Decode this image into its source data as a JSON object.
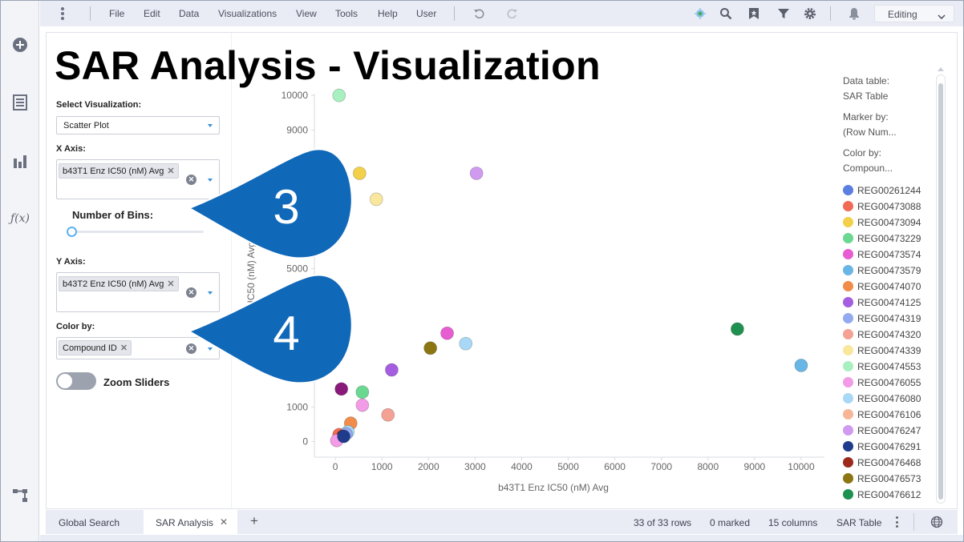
{
  "menubar": {
    "items": [
      "File",
      "Edit",
      "Data",
      "Visualizations",
      "View",
      "Tools",
      "Help",
      "User"
    ],
    "mode": "Editing"
  },
  "page": {
    "title": "SAR Analysis - Visualization"
  },
  "controls": {
    "select_visualization_label": "Select Visualization:",
    "select_visualization_value": "Scatter Plot",
    "x_axis_label": "X Axis:",
    "x_axis_chip": "b43T1 Enz IC50 (nM) Avg",
    "bins_label": "Number of Bins:",
    "y_axis_label": "Y Axis:",
    "y_axis_chip": "b43T2 Enz IC50 (nM) Avg",
    "color_by_label": "Color by:",
    "color_by_chip": "Compound ID",
    "zoom_label": "Zoom Sliders"
  },
  "callouts": [
    "3",
    "4"
  ],
  "legend": {
    "data_table_label": "Data table:",
    "data_table_value": "SAR Table",
    "marker_by_label": "Marker by:",
    "marker_by_value": "(Row Num...",
    "color_by_label": "Color by:",
    "color_by_value": "Compoun...",
    "items": [
      {
        "id": "REG00261244",
        "color": "#5b7fe0"
      },
      {
        "id": "REG00473088",
        "color": "#f06a55"
      },
      {
        "id": "REG00473094",
        "color": "#f3d049"
      },
      {
        "id": "REG00473229",
        "color": "#6ad891"
      },
      {
        "id": "REG00473574",
        "color": "#e85cd2"
      },
      {
        "id": "REG00473579",
        "color": "#69b5e6"
      },
      {
        "id": "REG00474070",
        "color": "#f28c4a"
      },
      {
        "id": "REG00474125",
        "color": "#a55ee0"
      },
      {
        "id": "REG00474319",
        "color": "#93aaf0"
      },
      {
        "id": "REG00474320",
        "color": "#f4a293"
      },
      {
        "id": "REG00474339",
        "color": "#f8e79c"
      },
      {
        "id": "REG00474553",
        "color": "#a8f0c0"
      },
      {
        "id": "REG00476055",
        "color": "#f29be6"
      },
      {
        "id": "REG00476080",
        "color": "#a9d8f6"
      },
      {
        "id": "REG00476106",
        "color": "#f7b697"
      },
      {
        "id": "REG00476247",
        "color": "#cf9af0"
      },
      {
        "id": "REG00476291",
        "color": "#1f3b8c"
      },
      {
        "id": "REG00476468",
        "color": "#9c2a1c"
      },
      {
        "id": "REG00476573",
        "color": "#8c7613"
      },
      {
        "id": "REG00476612",
        "color": "#1e9150"
      }
    ]
  },
  "chart_data": {
    "type": "scatter",
    "xlabel": "b43T1 Enz IC50 (nM) Avg",
    "ylabel": "b43T2 Enz IC50 (nM) Avg",
    "xlim": [
      -450,
      10500
    ],
    "ylim": [
      -450,
      10050
    ],
    "xticks": [
      0,
      1000,
      2000,
      3000,
      4000,
      5000,
      6000,
      7000,
      8000,
      9000,
      10000
    ],
    "yticks": [
      0,
      1000,
      5000,
      9000,
      10000
    ],
    "points": [
      {
        "x": 80,
        "y": 10000,
        "color": "#a8f0c0"
      },
      {
        "x": 520,
        "y": 7750,
        "color": "#f3d049"
      },
      {
        "x": 3030,
        "y": 7750,
        "color": "#cf9af0"
      },
      {
        "x": 880,
        "y": 7000,
        "color": "#f8e79c"
      },
      {
        "x": 8630,
        "y": 3250,
        "color": "#1e9150"
      },
      {
        "x": 2400,
        "y": 3130,
        "color": "#e85cd2"
      },
      {
        "x": 2800,
        "y": 2830,
        "color": "#a9d8f6"
      },
      {
        "x": 2040,
        "y": 2700,
        "color": "#8c7613"
      },
      {
        "x": 10000,
        "y": 2200,
        "color": "#69b5e6"
      },
      {
        "x": 1210,
        "y": 2070,
        "color": "#a55ee0"
      },
      {
        "x": 130,
        "y": 1520,
        "color": "#8a1a7a"
      },
      {
        "x": 580,
        "y": 1430,
        "color": "#6ad891"
      },
      {
        "x": 580,
        "y": 1050,
        "color": "#f29be6"
      },
      {
        "x": 1130,
        "y": 770,
        "color": "#f4a293"
      },
      {
        "x": 330,
        "y": 530,
        "color": "#f28c4a"
      },
      {
        "x": 80,
        "y": 200,
        "color": "#f06a55"
      },
      {
        "x": 270,
        "y": 280,
        "color": "#a9d8f6"
      },
      {
        "x": 230,
        "y": 220,
        "color": "#93aaf0"
      },
      {
        "x": 160,
        "y": 150,
        "color": "#9c2a1c"
      },
      {
        "x": 30,
        "y": 30,
        "color": "#f29be6"
      },
      {
        "x": 180,
        "y": 150,
        "color": "#1f3b8c"
      }
    ]
  },
  "tabs": [
    {
      "label": "Global Search",
      "active": false
    },
    {
      "label": "SAR Analysis",
      "active": true
    }
  ],
  "status": {
    "rows": "33 of 33 rows",
    "marked": "0 marked",
    "columns": "15 columns",
    "table": "SAR Table"
  }
}
